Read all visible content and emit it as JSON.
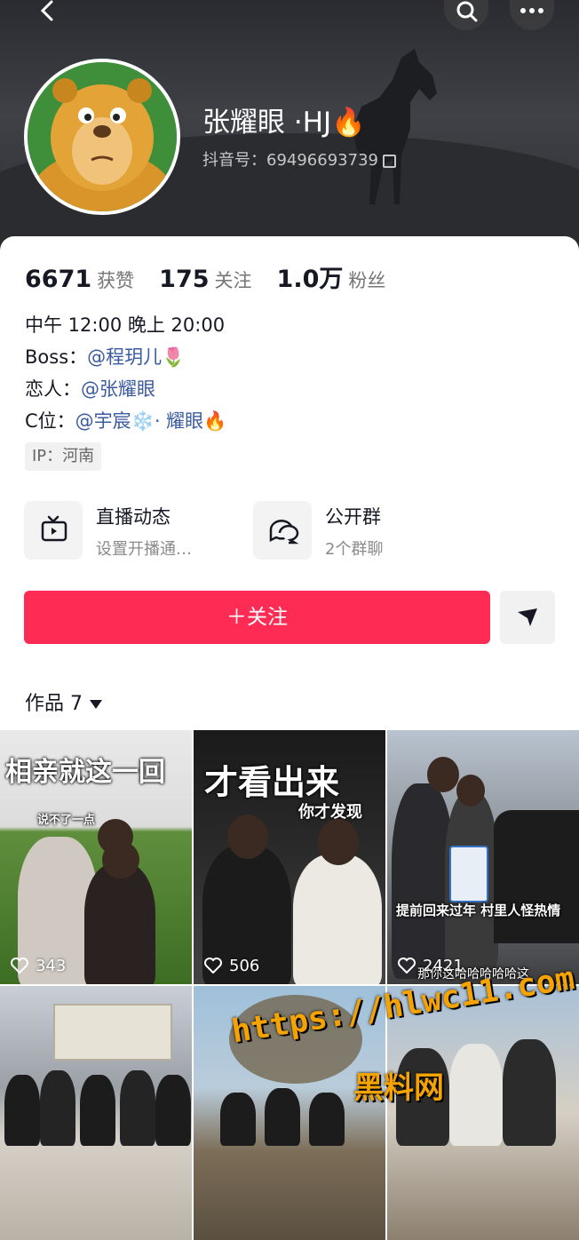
{
  "profile": {
    "name": "张耀眼 ·HJ🔥",
    "douyin_id": "抖音号：69496693739"
  },
  "stats": [
    {
      "value": "6671",
      "label": "获赞"
    },
    {
      "value": "175",
      "label": "关注"
    },
    {
      "value": "1.0万",
      "label": "粉丝"
    }
  ],
  "bio": {
    "line1": "中午 12:00 晚上 20:00",
    "boss_label": "Boss：",
    "boss_link": "@程玥儿🌷",
    "lover_label": "恋人：",
    "lover_link": "@张耀眼",
    "c_label": "C位：",
    "c_link": "@宇宸❄️· 耀眼🔥"
  },
  "ip": "IP：河南",
  "features": [
    {
      "title": "直播动态",
      "subtitle": "设置开播通…",
      "icon": "tv-icon"
    },
    {
      "title": "公开群",
      "subtitle": "2个群聊",
      "icon": "chat-group-icon"
    }
  ],
  "follow_label": "＋关注",
  "works": {
    "label": "作品",
    "count": "7"
  },
  "videos": [
    {
      "caption": "相亲就这一回",
      "subcaption": "说不了一点",
      "likes": "343"
    },
    {
      "caption": "才看出来",
      "subcaption": "你才发现",
      "likes": "506"
    },
    {
      "caption": "提前回来过年 村里人怪热情",
      "subcaption": "那你这哈哈哈哈哈这",
      "likes": "2421"
    },
    {
      "caption": "",
      "subcaption": "",
      "likes": ""
    },
    {
      "caption": "",
      "subcaption": "",
      "likes": ""
    },
    {
      "caption": "",
      "subcaption": "",
      "likes": ""
    }
  ],
  "watermark": {
    "url": "https://hlwc11.com",
    "name": "黑料网"
  },
  "colors": {
    "accent": "#fe2c55",
    "link": "#3a5ba0",
    "watermark": "#f5a300"
  }
}
